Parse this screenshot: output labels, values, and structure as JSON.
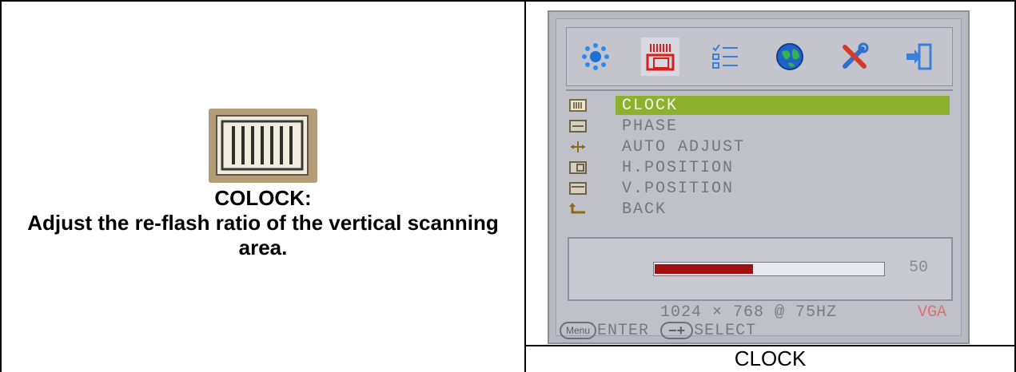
{
  "left_panel": {
    "title": "COLOCK:",
    "description": "Adjust the re-flash ratio of the vertical scanning area."
  },
  "osd": {
    "icons": [
      {
        "name": "brightness-icon",
        "active": false
      },
      {
        "name": "clock-image-icon",
        "active": true
      },
      {
        "name": "options-list-icon",
        "active": false
      },
      {
        "name": "language-globe-icon",
        "active": false
      },
      {
        "name": "tools-icon",
        "active": false
      },
      {
        "name": "exit-icon",
        "active": false
      }
    ],
    "menu": [
      {
        "label": "CLOCK",
        "icon": "clock-icon",
        "selected": true
      },
      {
        "label": "PHASE",
        "icon": "phase-icon",
        "selected": false
      },
      {
        "label": "AUTO ADJUST",
        "icon": "auto-adjust-icon",
        "selected": false
      },
      {
        "label": "H.POSITION",
        "icon": "h-position-icon",
        "selected": false
      },
      {
        "label": "V.POSITION",
        "icon": "v-position-icon",
        "selected": false
      },
      {
        "label": "BACK",
        "icon": "back-arrow-icon",
        "selected": false
      }
    ],
    "slider": {
      "value": "50",
      "fill_percent": 43
    },
    "resolution": "1024 × 768 @ 75HZ",
    "signal": "VGA",
    "footer": {
      "menu_key": "Menu",
      "enter_label": "ENTER",
      "select_key": "−+",
      "select_label": "SELECT"
    },
    "colors": {
      "highlight": "#8cb22d",
      "slider_fill": "#a11010",
      "signal": "#e06d74"
    }
  },
  "caption": "CLOCK"
}
